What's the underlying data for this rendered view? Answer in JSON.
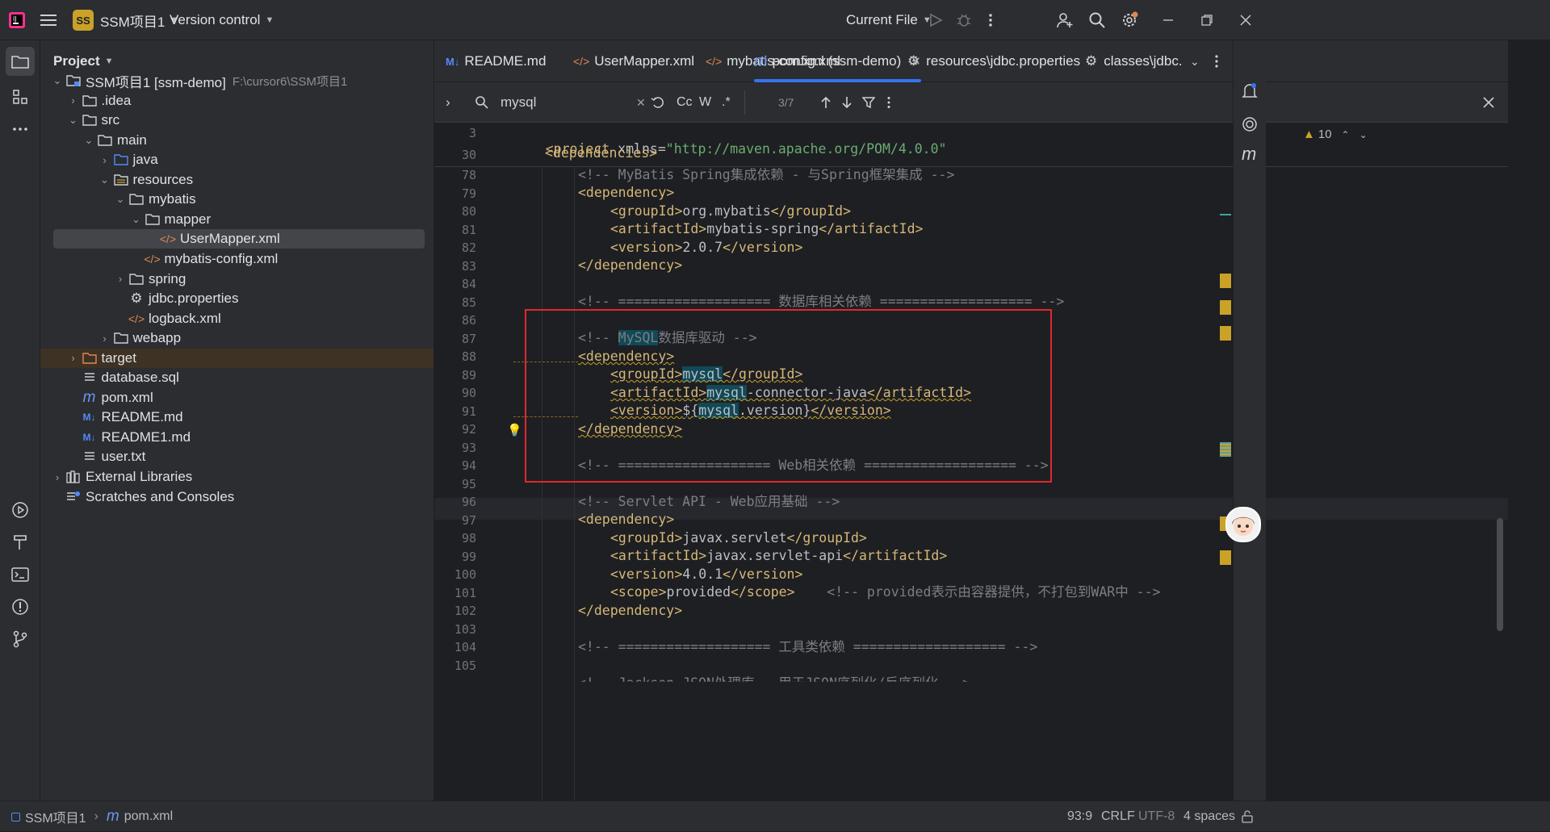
{
  "titlebar": {
    "project_badge": "SS",
    "project_name": "SSM项目1",
    "vcs_label": "Version control",
    "run_config": "Current File"
  },
  "project_panel": {
    "title": "Project",
    "tree": [
      {
        "label": "SSM项目1 [ssm-demo]",
        "hint": "F:\\cursor6\\SSM项目1",
        "icon": "module-folder-icon",
        "depth": 0,
        "expanded": true
      },
      {
        "label": ".idea",
        "icon": "folder-icon",
        "depth": 1,
        "expanded": false
      },
      {
        "label": "src",
        "icon": "folder-icon",
        "depth": 1,
        "expanded": true
      },
      {
        "label": "main",
        "icon": "folder-icon",
        "depth": 2,
        "expanded": true
      },
      {
        "label": "java",
        "icon": "source-folder-icon",
        "depth": 3,
        "expanded": false
      },
      {
        "label": "resources",
        "icon": "resources-folder-icon",
        "depth": 3,
        "expanded": true
      },
      {
        "label": "mybatis",
        "icon": "folder-icon",
        "depth": 4,
        "expanded": true
      },
      {
        "label": "mapper",
        "icon": "folder-icon",
        "depth": 5,
        "expanded": true
      },
      {
        "label": "UserMapper.xml",
        "icon": "xml-file-icon",
        "depth": 6,
        "selected": true
      },
      {
        "label": "mybatis-config.xml",
        "icon": "xml-file-icon",
        "depth": 5
      },
      {
        "label": "spring",
        "icon": "folder-icon",
        "depth": 4,
        "expanded": false
      },
      {
        "label": "jdbc.properties",
        "icon": "properties-file-icon",
        "depth": 4
      },
      {
        "label": "logback.xml",
        "icon": "xml-file-icon",
        "depth": 4
      },
      {
        "label": "webapp",
        "icon": "folder-icon",
        "depth": 3,
        "expanded": false
      },
      {
        "label": "target",
        "icon": "excluded-folder-icon",
        "depth": 1,
        "expanded": false,
        "excluded": true
      },
      {
        "label": "database.sql",
        "icon": "text-file-icon",
        "depth": 1
      },
      {
        "label": "pom.xml",
        "icon": "maven-file-icon",
        "depth": 1
      },
      {
        "label": "README.md",
        "icon": "markdown-file-icon",
        "depth": 1
      },
      {
        "label": "README1.md",
        "icon": "markdown-file-icon",
        "depth": 1
      },
      {
        "label": "user.txt",
        "icon": "text-file-icon",
        "depth": 1
      },
      {
        "label": "External Libraries",
        "icon": "library-icon",
        "depth": 0,
        "expanded": false
      },
      {
        "label": "Scratches and Consoles",
        "icon": "scratches-icon",
        "depth": 0
      }
    ]
  },
  "tabs": [
    {
      "label": "README.md",
      "icon": "markdown-file-icon"
    },
    {
      "label": "UserMapper.xml",
      "icon": "xml-file-icon"
    },
    {
      "label": "mybatis-config.xml",
      "icon": "xml-file-icon"
    },
    {
      "label": "pom.xml (ssm-demo)",
      "icon": "maven-file-icon",
      "active": true
    },
    {
      "label": "resources\\jdbc.properties",
      "icon": "gear-file-icon"
    },
    {
      "label": "classes\\jdbc.pro",
      "icon": "gear-file-icon"
    }
  ],
  "search": {
    "query": "mysql",
    "match_count": "3/7",
    "case_label": "Cc",
    "word_label": "W",
    "regex_label": ".*"
  },
  "editor": {
    "warning_count": "10",
    "sticky_lines": [
      {
        "num": "3",
        "text": "<project xmlns=\"http://maven.apache.org/POM/4.0.0\""
      },
      {
        "num": "30",
        "text": "<dependencies>"
      }
    ],
    "line_numbers": [
      "78",
      "79",
      "80",
      "81",
      "82",
      "83",
      "84",
      "85",
      "86",
      "87",
      "88",
      "89",
      "90",
      "91",
      "92",
      "93",
      "94",
      "95",
      "96",
      "97",
      "98",
      "99",
      "100",
      "101",
      "102",
      "103",
      "104",
      "105"
    ],
    "lines": {
      "l78": "<!-- MyBatis Spring集成依赖 - 与Spring框架集成 -->",
      "l79_tag": "<dependency>",
      "l80_open": "<groupId>",
      "l80_val": "org.mybatis",
      "l80_close": "</groupId>",
      "l81_open": "<artifactId>",
      "l81_val": "mybatis-spring",
      "l81_close": "</artifactId>",
      "l82_open": "<version>",
      "l82_val": "2.0.7",
      "l82_close": "</version>",
      "l83_tag": "</dependency>",
      "l85": "<!-- =================== 数据库相关依赖 =================== -->",
      "l87_pre": "<!-- ",
      "l87_hl": "MySQL",
      "l87_post": "数据库驱动 -->",
      "l88_tag": "<dependency>",
      "l89_open": "<groupId>",
      "l89_hl": "mysql",
      "l89_close": "</groupId>",
      "l90_open": "<artifactId>",
      "l90_hl": "mysql",
      "l90_rest": "-connector-java",
      "l90_close": "</artifactId>",
      "l91_open": "<version>",
      "l91_pre": "${",
      "l91_hl": "mysql",
      "l91_rest": ".version}",
      "l91_close": "</version>",
      "l92_tag": "</dependency>",
      "l94": "<!-- =================== Web相关依赖 =================== -->",
      "l96": "<!-- Servlet API - Web应用基础 -->",
      "l97_tag": "<dependency>",
      "l98_open": "<groupId>",
      "l98_val": "javax.servlet",
      "l98_close": "</groupId>",
      "l99_open": "<artifactId>",
      "l99_val": "javax.servlet-api",
      "l99_close": "</artifactId>",
      "l100_open": "<version>",
      "l100_val": "4.0.1",
      "l100_close": "</version>",
      "l101_open": "<scope>",
      "l101_val": "provided",
      "l101_close": "</scope>",
      "l101_cmt": "<!-- provided表示由容器提供，不打包到WAR中 -->",
      "l102_tag": "</dependency>",
      "l104": "<!-- =================== 工具类依赖 =================== -->",
      "l106": "<!-- Jackson JSON处理库 - 用于JSON序列化/反序列化 -->"
    }
  },
  "statusbar": {
    "breadcrumb_project": "SSM项目1",
    "breadcrumb_file": "pom.xml",
    "position": "93:9",
    "line_sep": "CRLF",
    "encoding": "UTF-8",
    "indent": "4 spaces"
  },
  "colors": {
    "accent": "#3574f0",
    "warning": "#c9a227",
    "highlight": "#114957",
    "annotation": "#e0282e"
  }
}
